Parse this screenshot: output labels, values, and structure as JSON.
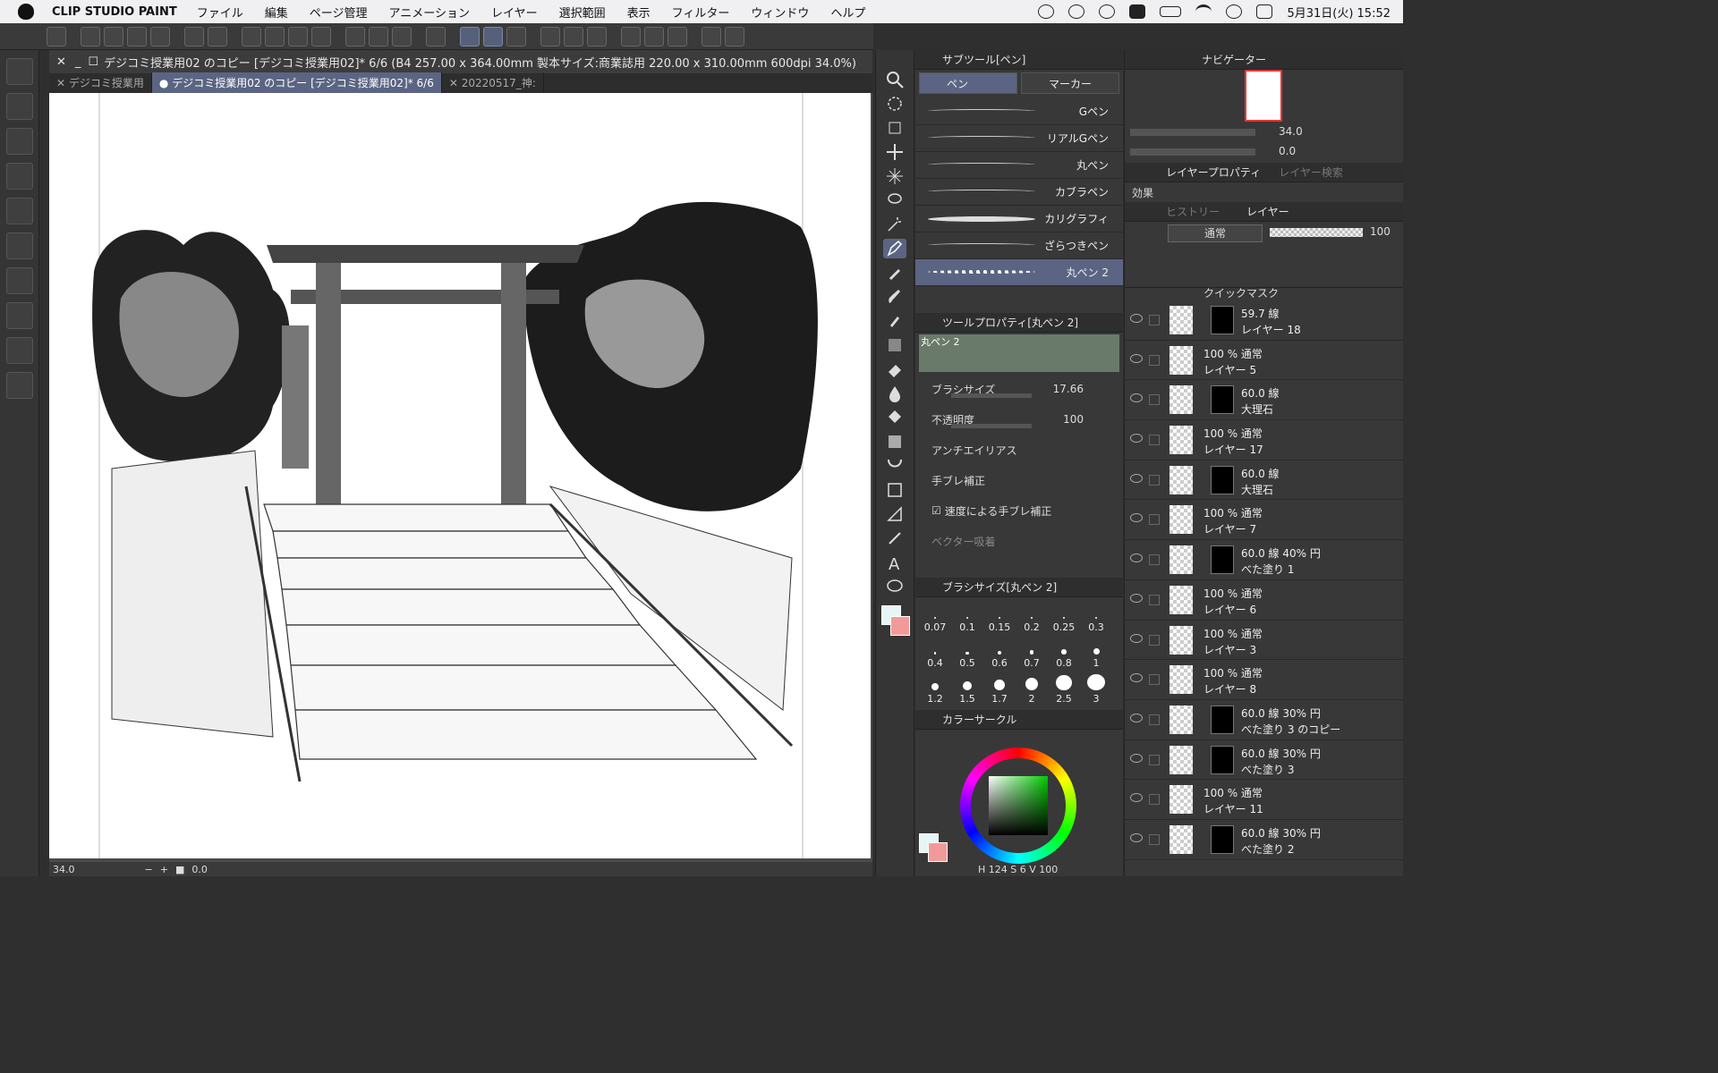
{
  "menubar": {
    "app_name": "CLIP STUDIO PAINT",
    "items": [
      "ファイル",
      "編集",
      "ページ管理",
      "アニメーション",
      "レイヤー",
      "選択範囲",
      "表示",
      "フィルター",
      "ウィンドウ",
      "ヘルプ"
    ],
    "clock": "5月31日(火) 15:52"
  },
  "document": {
    "title": "デジコミ授業用02 のコピー [デジコミ授業用02]* 6/6 (B4 257.00 x 364.00mm 製本サイズ:商業誌用 220.00 x 310.00mm 600dpi 34.0%)",
    "tabs": [
      "デジコミ授業用",
      "デジコミ授業用02 のコピー [デジコミ授業用02]* 6/6",
      "20220517_神:"
    ],
    "zoom": "34.0",
    "rotation": "0.0"
  },
  "subtool": {
    "title": "サブツール[ペン]",
    "tabs": [
      "ペン",
      "マーカー"
    ],
    "brushes": [
      "Gペン",
      "リアルGペン",
      "丸ペン",
      "カブラペン",
      "カリグラフィ",
      "ざらつきペン",
      "丸ペン 2"
    ],
    "selected": "丸ペン 2"
  },
  "toolprop": {
    "title": "ツールプロパティ[丸ペン 2]",
    "preview_name": "丸ペン 2",
    "brush_size_label": "ブラシサイズ",
    "brush_size_value": "17.66",
    "opacity_label": "不透明度",
    "opacity_value": "100",
    "antialias_label": "アンチエイリアス",
    "stabilizer_label": "手ブレ補正",
    "speed_stabilizer_label": "速度による手ブレ補正",
    "vector_label": "ベクター吸着"
  },
  "brushsize": {
    "title": "ブラシサイズ[丸ペン 2]",
    "sizes": [
      "0.07",
      "0.1",
      "0.15",
      "0.2",
      "0.25",
      "0.3",
      "0.4",
      "0.5",
      "0.6",
      "0.7",
      "0.8",
      "1",
      "1.2",
      "1.5",
      "1.7",
      "2",
      "2.5",
      "3"
    ]
  },
  "colorcircle": {
    "title": "カラーサークル",
    "h": "124",
    "s": "6",
    "v": "100"
  },
  "navigator": {
    "title": "ナビゲーター",
    "zoom": "34.0",
    "rotate": "0.0"
  },
  "layerprop": {
    "title": "レイヤープロパティ",
    "search_tab": "レイヤー検索",
    "effect_label": "効果"
  },
  "layers": {
    "history_tab": "ヒストリー",
    "layers_tab": "レイヤー",
    "blend_mode": "通常",
    "opacity": "100",
    "quickmask": "クイックマスク",
    "items": [
      {
        "info": "59.7 線",
        "name": "レイヤー 18"
      },
      {
        "info": "100 % 通常",
        "name": "レイヤー 5"
      },
      {
        "info": "60.0 線",
        "name": "大理石"
      },
      {
        "info": "100 % 通常",
        "name": "レイヤー 17"
      },
      {
        "info": "60.0 線",
        "name": "大理石"
      },
      {
        "info": "100 % 通常",
        "name": "レイヤー 7"
      },
      {
        "info": "60.0 線 40% 円",
        "name": "べた塗り 1"
      },
      {
        "info": "100 % 通常",
        "name": "レイヤー 6"
      },
      {
        "info": "100 % 通常",
        "name": "レイヤー 3"
      },
      {
        "info": "100 % 通常",
        "name": "レイヤー 8"
      },
      {
        "info": "60.0 線 30% 円",
        "name": "べた塗り 3 のコピー"
      },
      {
        "info": "60.0 線 30% 円",
        "name": "べた塗り 3"
      },
      {
        "info": "100 % 通常",
        "name": "レイヤー 11"
      },
      {
        "info": "60.0 線 30% 円",
        "name": "べた塗り 2"
      }
    ]
  },
  "colors": {
    "accent": "#5b6583",
    "main_color": "#e6f6f7",
    "sub_color": "#f29a9a"
  }
}
